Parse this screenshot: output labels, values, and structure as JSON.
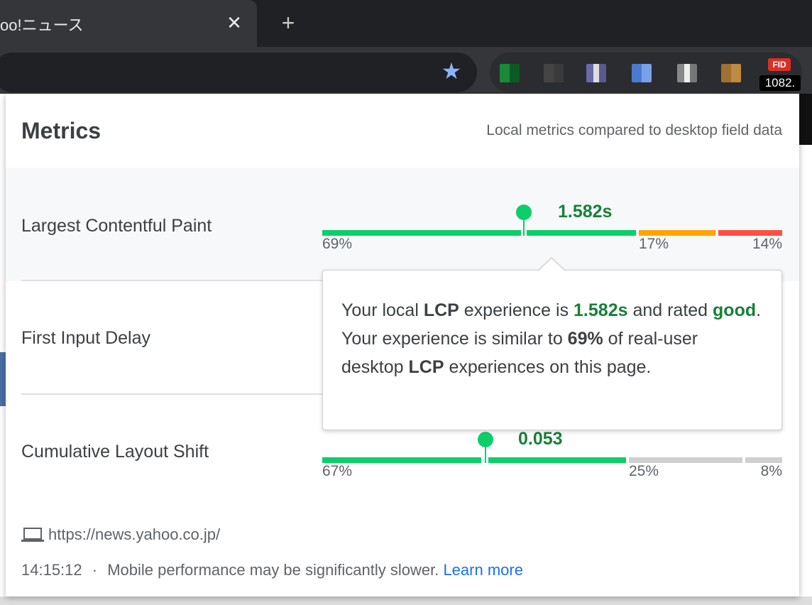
{
  "browser": {
    "tab_title": "oo!ニュース",
    "tab_close": "✕",
    "new_tab": "+",
    "bookmark_star": "★",
    "extension_badge": {
      "label": "FID",
      "value": "1082."
    }
  },
  "popup": {
    "title": "Metrics",
    "subtitle": "Local metrics compared to desktop field data",
    "metrics": [
      {
        "name": "Largest Contentful Paint",
        "value": "1.582s",
        "good_pct": "69%",
        "ni_pct": "17%",
        "poor_pct": "14%",
        "good": 69,
        "ni": 17,
        "poor": 14
      },
      {
        "name": "First Input Delay"
      },
      {
        "name": "Cumulative Layout Shift",
        "value": "0.053",
        "good_pct": "67%",
        "ni_pct": "25%",
        "poor_pct": "8%",
        "good": 67,
        "ni": 25,
        "poor": 8
      }
    ],
    "tooltip": {
      "t1": "Your local ",
      "t2": "LCP",
      "t3": " experience is ",
      "t4": "1.582s",
      "t5": " and rated ",
      "t6": "good",
      "t7": ". Your experience is similar to ",
      "t8": "69%",
      "t9": " of real-user desktop ",
      "t10": "LCP",
      "t11": " experiences on this page."
    },
    "footer": {
      "url": "https://news.yahoo.co.jp/",
      "time": "14:15:12",
      "separator": "·",
      "note": "Mobile performance may be significantly slower.",
      "learn_more": "Learn more"
    }
  },
  "colors": {
    "good": "#0cce6b",
    "needs_improvement": "#ffa400",
    "poor": "#ff4e42",
    "value_text": "#188038",
    "link": "#1a73e8"
  }
}
